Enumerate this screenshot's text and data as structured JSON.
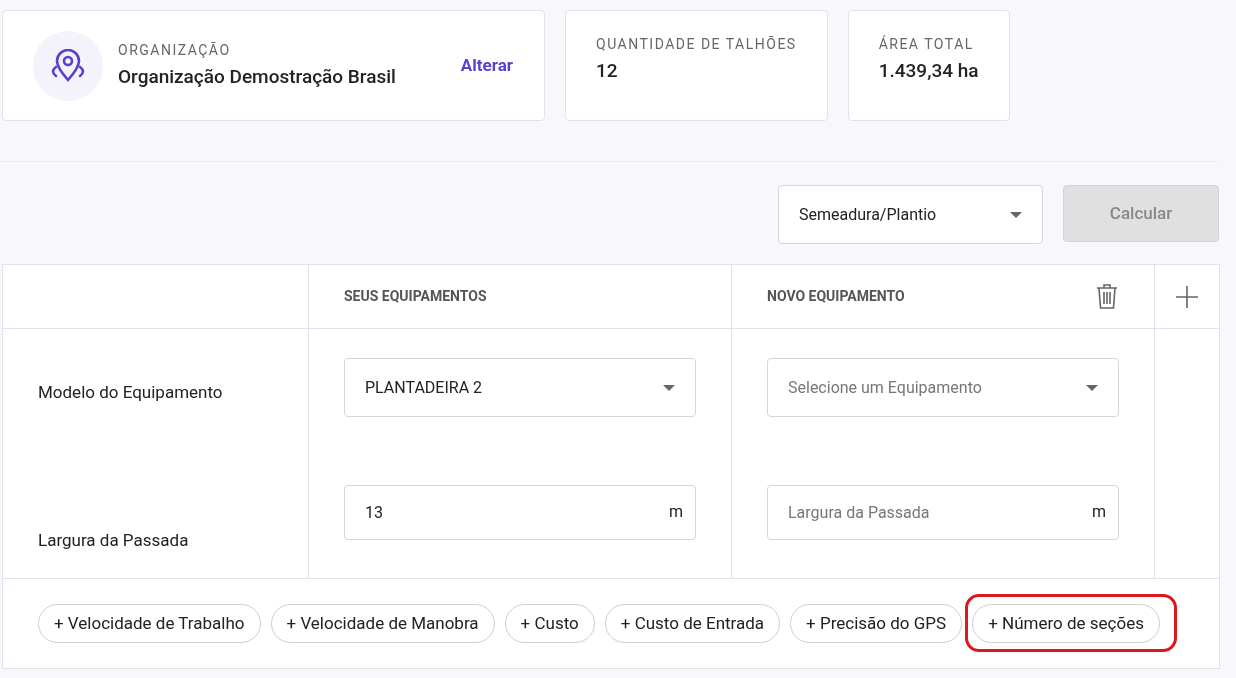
{
  "summary_cards": [
    {
      "kind": "organization",
      "label": "ORGANIZAÇÃO",
      "value": "Organização Demostração Brasil",
      "action": "Alterar"
    },
    {
      "kind": "stat",
      "label": "QUANTIDADE DE TALHÕES",
      "value": "12"
    },
    {
      "kind": "stat",
      "label": "ÁREA TOTAL",
      "value": "1.439,34 ha"
    }
  ],
  "operation_select": {
    "value": "Semeadura/Plantio"
  },
  "calculate_button": {
    "label": "Calcular",
    "disabled": true
  },
  "table": {
    "columns": [
      "SEUS EQUIPAMENTOS",
      "NOVO EQUIPAMENTO"
    ],
    "rows": [
      {
        "kind": "select",
        "label": "Modelo do Equipamento",
        "current": {
          "value": "PLANTADEIRA 2"
        },
        "new": {
          "placeholder": "Selecione um Equipamento"
        }
      },
      {
        "kind": "input",
        "label": "Largura da Passada",
        "current": {
          "value": "13",
          "unit": "m"
        },
        "new": {
          "placeholder": "Largura da Passada",
          "unit": "m"
        }
      }
    ],
    "optional_fields": [
      {
        "label": "+ Velocidade de Trabalho",
        "highlighted": false
      },
      {
        "label": "+ Velocidade de Manobra",
        "highlighted": false
      },
      {
        "label": "+ Custo",
        "highlighted": false
      },
      {
        "label": "+ Custo de Entrada",
        "highlighted": false
      },
      {
        "label": "+ Precisão do GPS",
        "highlighted": false
      },
      {
        "label": "+ Número de seções",
        "highlighted": true
      }
    ]
  }
}
